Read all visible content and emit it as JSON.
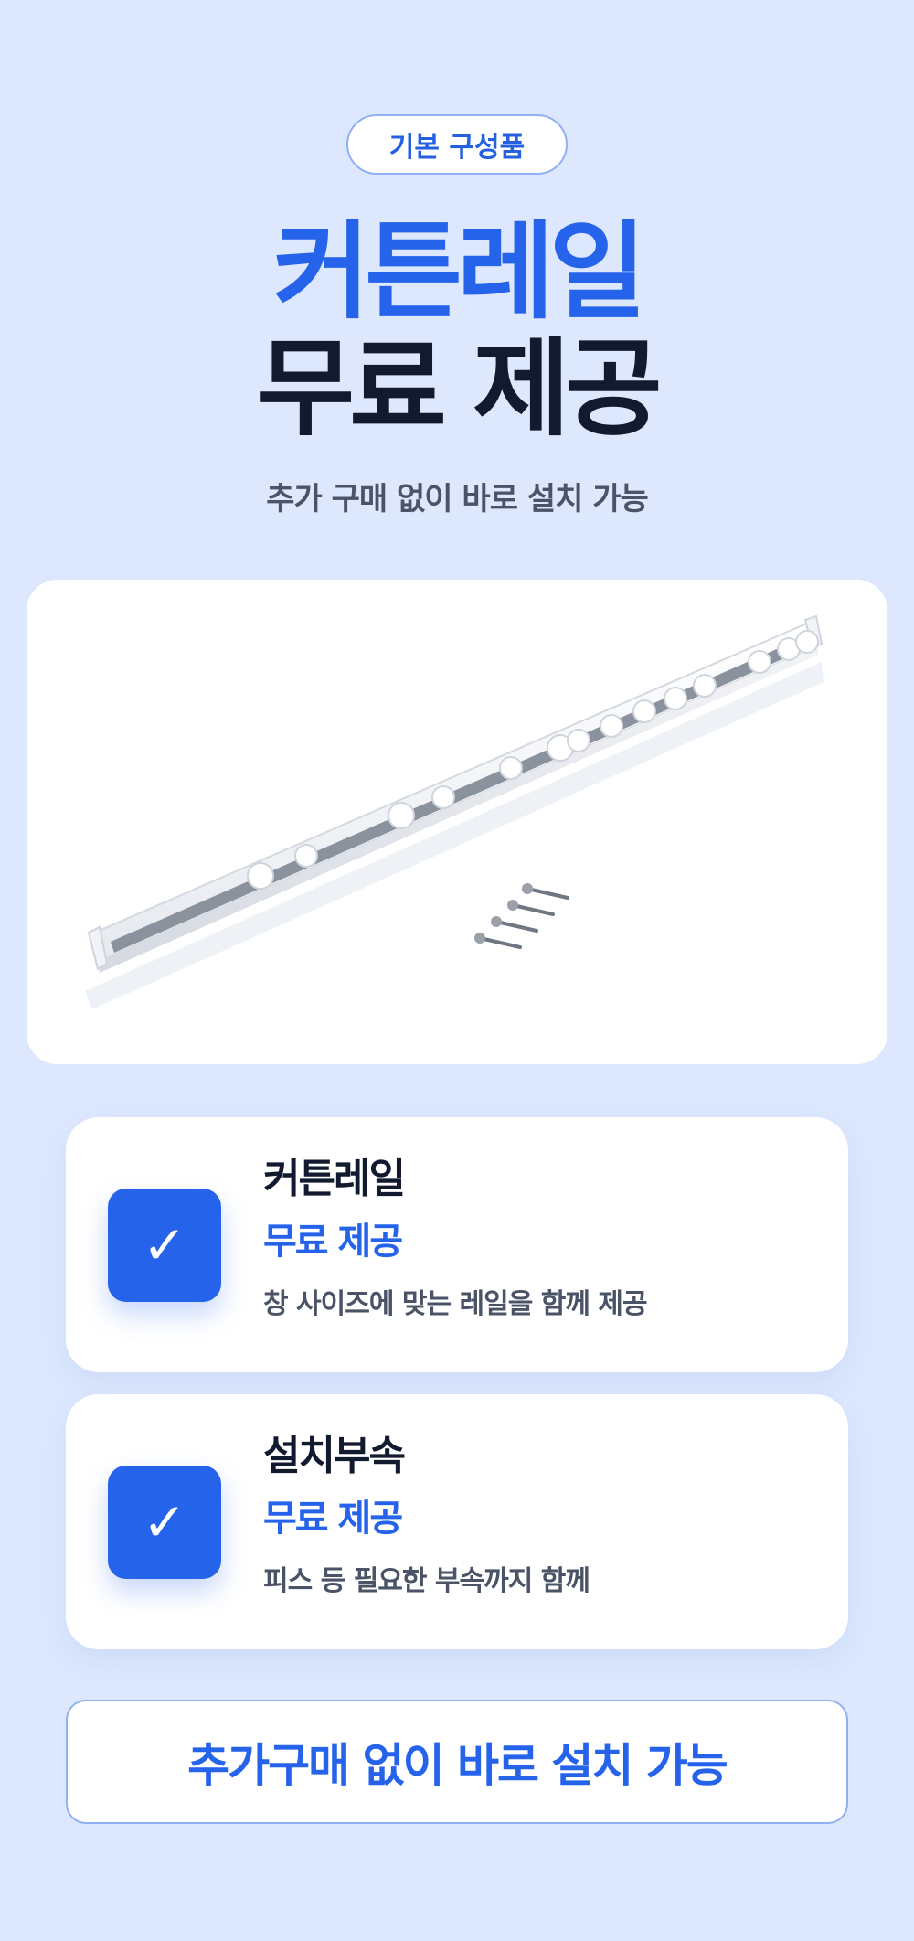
{
  "badge": {
    "label": "기본 구성품"
  },
  "headline": {
    "line1": "커튼레일",
    "line2": "무료 제공"
  },
  "subtitle": "추가 구매 없이 바로 설치 가능",
  "product_image": {
    "alt": "curtain rail with hooks and screws"
  },
  "features": [
    {
      "icon": "check-icon",
      "title": "커튼레일",
      "subtitle": "무료 제공",
      "description": "창 사이즈에 맞는 레일을 함께 제공"
    },
    {
      "icon": "check-icon",
      "title": "설치부속",
      "subtitle": "무료 제공",
      "description": "피스 등 필요한 부속까지 함께"
    }
  ],
  "cta": {
    "label": "추가구매 없이 바로 설치 가능"
  },
  "colors": {
    "background": "#dde8fe",
    "accent": "#2563eb",
    "dark_text": "#111a2e",
    "muted_text": "#4b5467"
  }
}
